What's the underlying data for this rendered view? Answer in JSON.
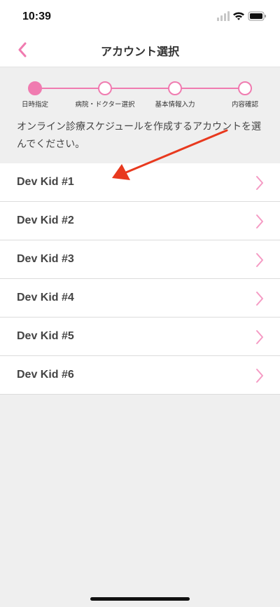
{
  "status_bar": {
    "time": "10:39"
  },
  "nav": {
    "title": "アカウント選択",
    "back_icon": "chevron-left-icon"
  },
  "steps": [
    {
      "label": "日時指定",
      "active": true
    },
    {
      "label": "病院・ドクター選択",
      "active": false
    },
    {
      "label": "基本情報入力",
      "active": false
    },
    {
      "label": "内容確認",
      "active": false
    }
  ],
  "instruction": "オンライン診療スケジュールを作成するアカウントを選んでください。",
  "accounts": [
    {
      "name": "Dev Kid #1"
    },
    {
      "name": "Dev Kid #2"
    },
    {
      "name": "Dev Kid #3"
    },
    {
      "name": "Dev Kid #4"
    },
    {
      "name": "Dev Kid #5"
    },
    {
      "name": "Dev Kid #6"
    }
  ],
  "colors": {
    "accent": "#f07bb0",
    "chevron": "#f59bc4",
    "annotation": "#e8391e",
    "background": "#efefef"
  }
}
